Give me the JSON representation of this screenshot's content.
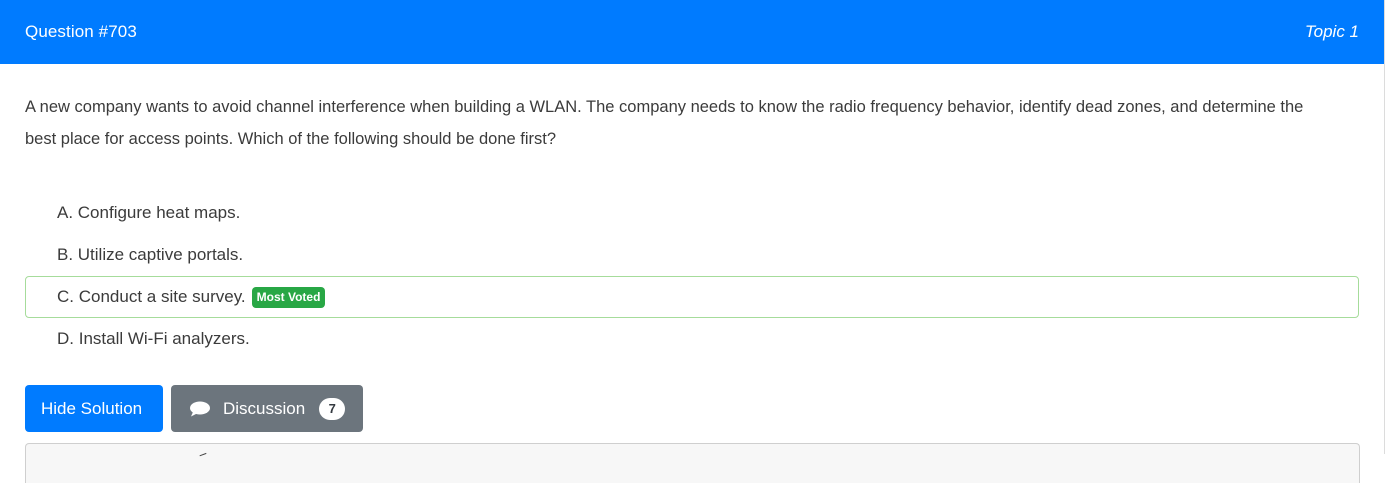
{
  "header": {
    "title": "Question #703",
    "topic": "Topic 1"
  },
  "question": {
    "text": "A new company wants to avoid channel interference when building a WLAN. The company needs to know the radio frequency behavior, identify dead zones, and determine the best place for access points. Which of the following should be done first?"
  },
  "choices": [
    {
      "label": "A. Configure heat maps."
    },
    {
      "label": "B. Utilize captive portals."
    },
    {
      "label": "C. Conduct a site survey.",
      "badge": "Most Voted"
    },
    {
      "label": "D. Install Wi-Fi analyzers."
    }
  ],
  "buttons": {
    "hide_solution": "Hide Solution",
    "discussion": "Discussion",
    "discussion_count": "7"
  },
  "colors": {
    "primary": "#007bff",
    "secondary": "#6c757d",
    "success": "#28a745",
    "correct_border": "#a6dc9b"
  },
  "icons": {
    "discussion": "chat-bubble-icon"
  }
}
